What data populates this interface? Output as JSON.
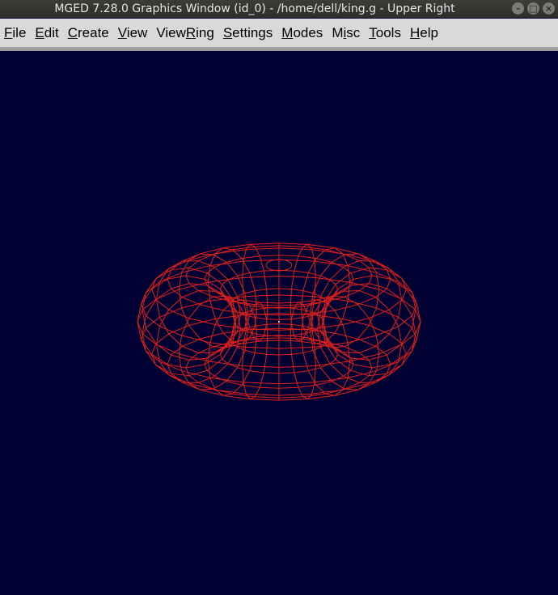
{
  "window": {
    "title": "MGED 7.28.0 Graphics Window (id_0) - /home/dell/king.g - Upper Right",
    "minimize_glyph": "–",
    "maximize_glyph": "□",
    "close_glyph": "×"
  },
  "menu": {
    "items": [
      {
        "pre": "",
        "u": "F",
        "post": "ile"
      },
      {
        "pre": "",
        "u": "E",
        "post": "dit"
      },
      {
        "pre": "",
        "u": "C",
        "post": "reate"
      },
      {
        "pre": "",
        "u": "V",
        "post": "iew"
      },
      {
        "pre": "View",
        "u": "R",
        "post": "ing"
      },
      {
        "pre": "",
        "u": "S",
        "post": "ettings"
      },
      {
        "pre": "",
        "u": "M",
        "post": "odes"
      },
      {
        "pre": "M",
        "u": "i",
        "post": "sc"
      },
      {
        "pre": "",
        "u": "T",
        "post": "ools"
      },
      {
        "pre": "",
        "u": "H",
        "post": "elp"
      }
    ]
  },
  "colors": {
    "background": "#000033",
    "wireframe": "#e0201a",
    "menubar": "#d9d9d9"
  },
  "viewport": {
    "icons": [
      "wireframe-torus",
      "center-dot-icon"
    ]
  }
}
